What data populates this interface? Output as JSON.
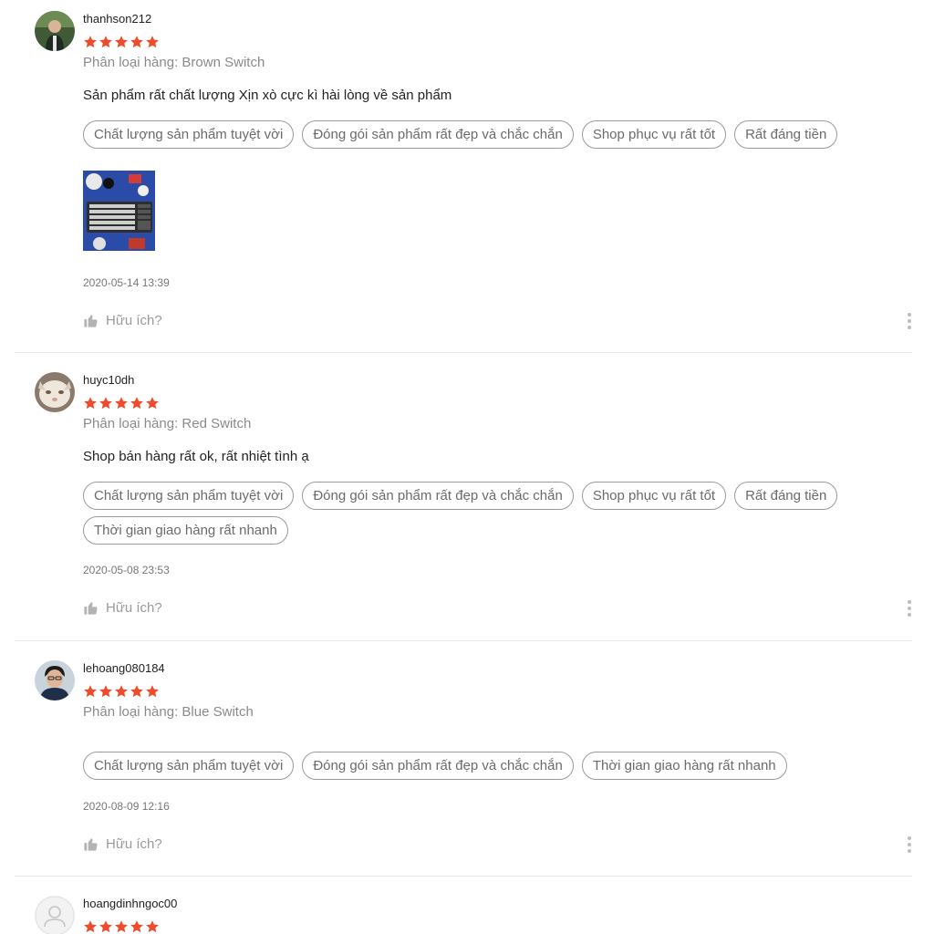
{
  "colors": {
    "star": "#ee4d2d",
    "tag_border": "#9a9a9a",
    "muted_text": "#8a8a8a",
    "divider": "#e8e8e8"
  },
  "reviews": [
    {
      "username": "thanhson212",
      "rating": 5,
      "variation": "Phân loại hàng: Brown Switch",
      "comment": "Sản phẩm rất chất lượng Xịn xò cực kì hài lòng về sản phẩm",
      "tags": [
        "Chất lượng sản phẩm tuyệt vời",
        "Đóng gói sản phẩm rất đẹp và chắc chắn",
        "Shop phục vụ rất tốt",
        "Rất đáng tiền"
      ],
      "timestamp": "2020-05-14 13:39",
      "helpful_label": "Hữu ích?"
    },
    {
      "username": "huyc10dh",
      "rating": 5,
      "variation": "Phân loại hàng: Red Switch",
      "comment": "Shop bán hàng rất ok, rất nhiệt tình ạ",
      "tags": [
        "Chất lượng sản phẩm tuyệt vời",
        "Đóng gói sản phẩm rất đẹp và chắc chắn",
        "Shop phục vụ rất tốt",
        "Rất đáng tiền",
        "Thời gian giao hàng rất nhanh"
      ],
      "timestamp": "2020-05-08 23:53",
      "helpful_label": "Hữu ích?"
    },
    {
      "username": "lehoang080184",
      "rating": 5,
      "variation": "Phân loại hàng: Blue Switch",
      "tags": [
        "Chất lượng sản phẩm tuyệt vời",
        "Đóng gói sản phẩm rất đẹp và chắc chắn",
        "Thời gian giao hàng rất nhanh"
      ],
      "timestamp": "2020-08-09 12:16",
      "helpful_label": "Hữu ích?"
    },
    {
      "username": "hoangdinhngoc00",
      "rating": 5
    }
  ]
}
